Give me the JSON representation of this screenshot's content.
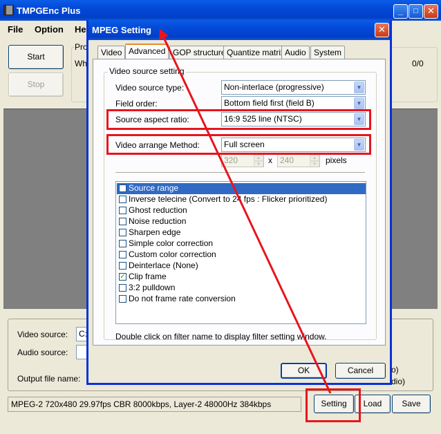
{
  "main_window": {
    "title": "TMPGEnc Plus",
    "menu": {
      "file": "File",
      "option": "Option",
      "help_partial": "He"
    },
    "start_label": "Start",
    "stop_label": "Stop",
    "progress_group_partial": "Pro",
    "progress_label_partial": "Wh",
    "counter": "0/0",
    "video_source_label": "Video source:",
    "video_source_value_partial": "C:\\",
    "audio_source_label": "Audio source:",
    "output_file_label": "Output file name:",
    "right_text_1_partial": "o)",
    "right_text_2_partial": "dio)",
    "status_text": "MPEG-2 720x480 29.97fps CBR 8000kbps,  Layer-2 48000Hz 384kbps",
    "setting_label": "Setting",
    "load_label": "Load",
    "save_label": "Save",
    "titlebar_buttons": {
      "minimize": "_",
      "maximize": "□",
      "close": "✕"
    }
  },
  "dialog": {
    "title": "MPEG Setting",
    "close_glyph": "✕",
    "tabs": [
      "Video",
      "Advanced",
      "GOP structure",
      "Quantize matrix",
      "Audio",
      "System"
    ],
    "active_tab": "Advanced",
    "group_title": "Video source setting",
    "video_source_type": {
      "label": "Video source type:",
      "value": "Non-interlace (progressive)"
    },
    "field_order": {
      "label": "Field order:",
      "value": "Bottom field first (field B)"
    },
    "source_aspect_ratio": {
      "label": "Source aspect ratio:",
      "value": "16:9 525 line (NTSC)"
    },
    "video_arrange_method": {
      "label": "Video arrange Method:",
      "value": "Full screen"
    },
    "width": "320",
    "height": "240",
    "x_label": "x",
    "pixels_label": "pixels",
    "filters": [
      {
        "label": "Source range",
        "checked": false,
        "selected": true
      },
      {
        "label": "Inverse telecine (Convert to 24 fps : Flicker prioritized)",
        "checked": false
      },
      {
        "label": "Ghost reduction",
        "checked": false
      },
      {
        "label": "Noise reduction",
        "checked": false
      },
      {
        "label": "Sharpen edge",
        "checked": false
      },
      {
        "label": "Simple color correction",
        "checked": false
      },
      {
        "label": "Custom color correction",
        "checked": false
      },
      {
        "label": "Deinterlace (None)",
        "checked": false
      },
      {
        "label": "Clip frame",
        "checked": true
      },
      {
        "label": "3:2 pulldown",
        "checked": false
      },
      {
        "label": "Do not frame rate conversion",
        "checked": false
      }
    ],
    "hint": "Double click on filter name to display filter setting window.",
    "ok_label": "OK",
    "cancel_label": "Cancel"
  },
  "annotation_colors": {
    "highlight": "#e8141c"
  }
}
